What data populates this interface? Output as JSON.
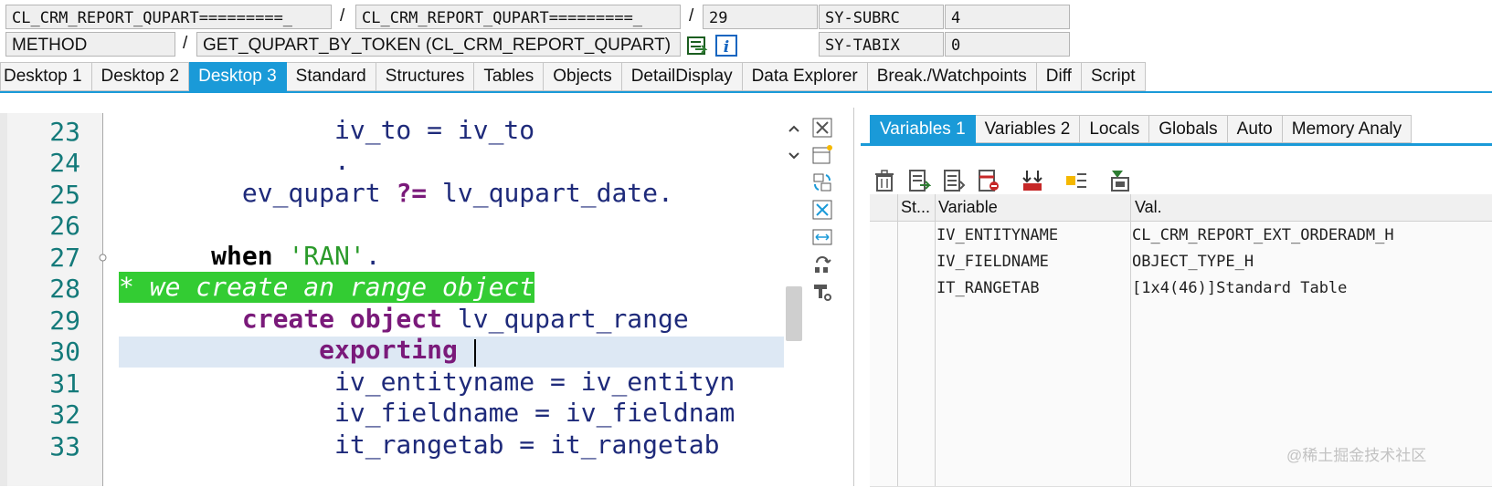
{
  "header": {
    "program1": "CL_CRM_REPORT_QUPART=========_",
    "sep1": "/",
    "program2": "CL_CRM_REPORT_QUPART=========_",
    "sep2": "/",
    "line": "29",
    "sysfield1": "SY-SUBRC",
    "sysval1": "4",
    "event_type": "METHOD",
    "sep3": "/",
    "event_name": "GET_QUPART_BY_TOKEN (CL_CRM_REPORT_QUPART)",
    "sysfield2": "SY-TABIX",
    "sysval2": "0"
  },
  "main_tabs": [
    "Desktop 1",
    "Desktop 2",
    "Desktop 3",
    "Standard",
    "Structures",
    "Tables",
    "Objects",
    "DetailDisplay",
    "Data Explorer",
    "Break./Watchpoints",
    "Diff",
    "Script"
  ],
  "main_tab_active": "Desktop 3",
  "code": {
    "line_numbers": [
      "23",
      "24",
      "25",
      "26",
      "27",
      "28",
      "29",
      "30",
      "31",
      "32",
      "33"
    ],
    "l23": "              iv_to = iv_to",
    "l24": "              .",
    "l25a": "        ev_qupart ",
    "l25b": "?=",
    "l25c": " lv_qupart_date.",
    "l27a": "      ",
    "l27b": "when",
    "l27c": " ",
    "l27d": "'RAN'",
    "l27e": ".",
    "l28": "* we create an range object",
    "l29a": "        ",
    "l29b": "create object",
    "l29c": " lv_qupart_range",
    "l30a": "             ",
    "l30b": "exporting",
    "l31": "              iv_entityname = iv_entityn",
    "l32": "              iv_fieldname = iv_fieldnam",
    "l33": "              it_rangetab = it_rangetab"
  },
  "var_tabs": [
    "Variables 1",
    "Variables 2",
    "Locals",
    "Globals",
    "Auto",
    "Memory Analy"
  ],
  "var_tab_active": "Variables 1",
  "grid": {
    "headers": [
      "St...",
      "Variable",
      "Val."
    ],
    "rows": [
      {
        "variable": "IV_ENTITYNAME",
        "value": "CL_CRM_REPORT_EXT_ORDERADM_H"
      },
      {
        "variable": "IV_FIELDNAME",
        "value": "OBJECT_TYPE_H"
      },
      {
        "variable": "IT_RANGETAB",
        "value": "[1x4(46)]Standard Table"
      }
    ]
  },
  "watermark": "@稀土掘金技术社区",
  "colors": {
    "accent": "#1a9ad8",
    "comment_bg": "#33cc33",
    "keyword_purple": "#7a1a7a",
    "line_number": "#147a7a"
  }
}
